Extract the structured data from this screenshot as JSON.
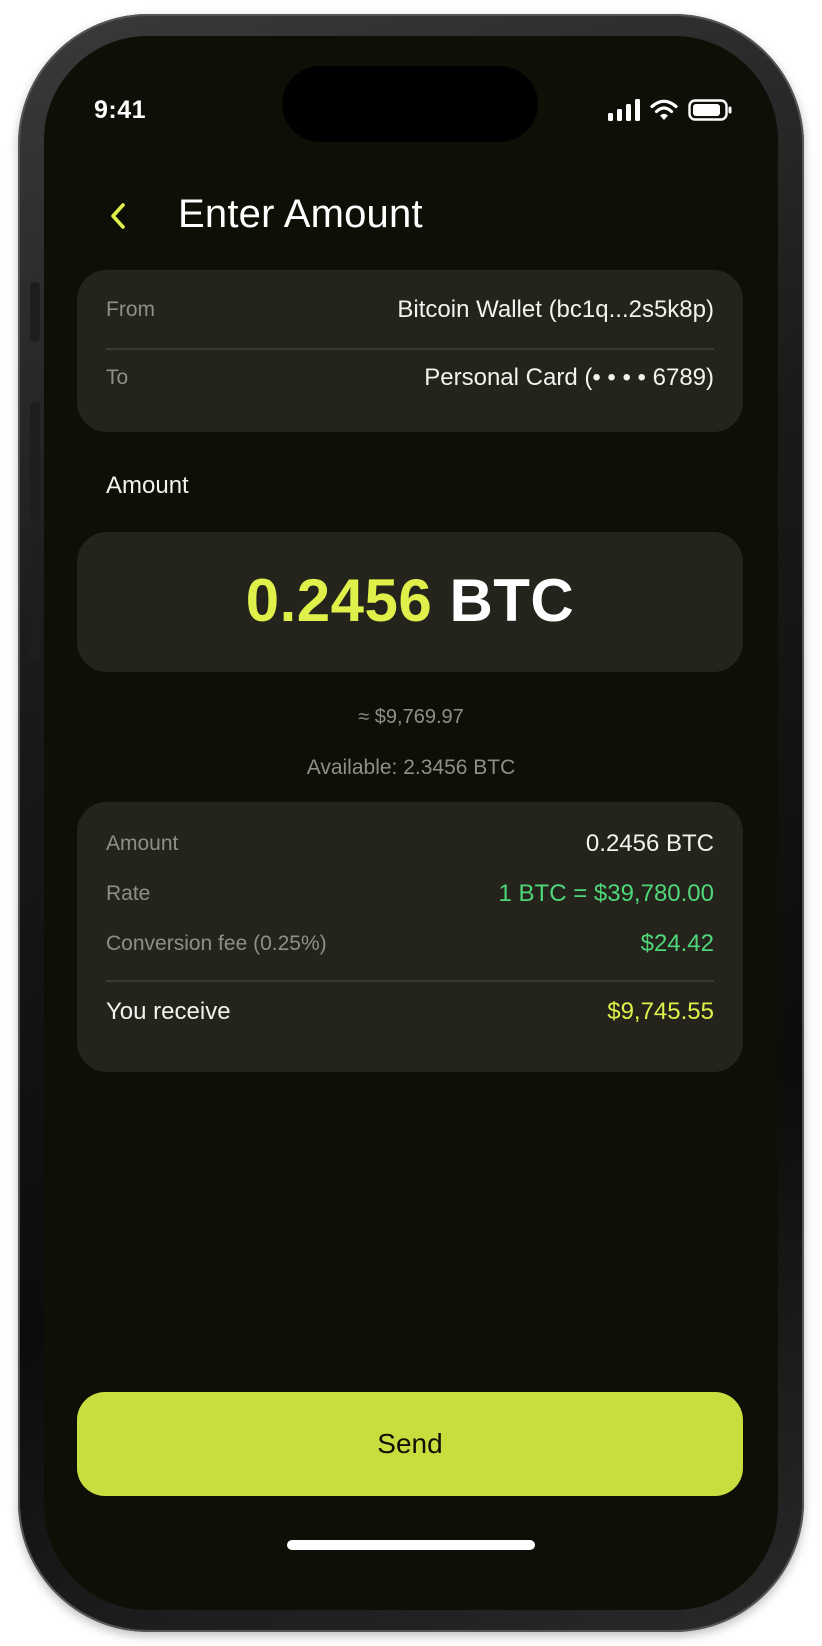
{
  "status_bar": {
    "time": "9:41",
    "icons": [
      "signal-icon",
      "wifi-icon",
      "battery-icon"
    ]
  },
  "header": {
    "back_icon": "chevron-left-icon",
    "title": "Enter Amount"
  },
  "transfer": {
    "from_label": "From",
    "from_value": "Bitcoin Wallet (bc1q...2s5k8p)",
    "to_label": "To",
    "to_value": "Personal Card (• • • • 6789)"
  },
  "amount": {
    "label": "Amount",
    "value": "0.2456",
    "unit": "BTC",
    "fiat_approx": "≈ $9,769.97",
    "available": "Available: 2.3456 BTC"
  },
  "summary": {
    "amount_label": "Amount",
    "amount_value": "0.2456 BTC",
    "rate_label": "Rate",
    "rate_value": "1 BTC = $39,780.00",
    "fee_label": "Conversion fee (0.25%)",
    "fee_value": "$24.42",
    "receive_label": "You receive",
    "receive_value": "$9,745.55"
  },
  "actions": {
    "send_label": "Send"
  },
  "colors": {
    "accent": "#dff04a",
    "button": "#c8de3e",
    "positive": "#4fd678",
    "background": "#0e0f06",
    "card": "#24241c"
  }
}
